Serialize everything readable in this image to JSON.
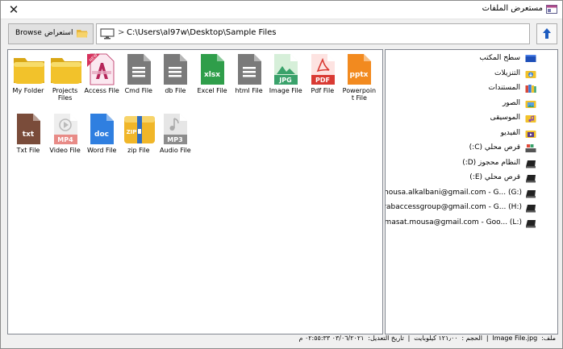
{
  "window": {
    "title": "مستعرض الملفات",
    "close_glyph": "✕"
  },
  "toolbar": {
    "browse_label_en": "Browse",
    "browse_label_ar": "استعراض",
    "path_separator": ">",
    "current_path": "C:\\Users\\al97w\\Desktop\\Sample Files"
  },
  "files": [
    {
      "name": "My Folder",
      "icon": "folder-icon"
    },
    {
      "name": "Projects Files",
      "icon": "folder-icon"
    },
    {
      "name": "Access File",
      "icon": "access-file-icon",
      "badge": "NEW"
    },
    {
      "name": "Cmd File",
      "icon": "cmd-file-icon"
    },
    {
      "name": "db File",
      "icon": "db-file-icon"
    },
    {
      "name": "Excel File",
      "icon": "excel-file-icon",
      "badge": "xlsx"
    },
    {
      "name": "html File",
      "icon": "html-file-icon"
    },
    {
      "name": "Image File",
      "icon": "image-file-icon",
      "badge": "JPG"
    },
    {
      "name": "Pdf File",
      "icon": "pdf-file-icon",
      "badge": "PDF"
    },
    {
      "name": "Powerpoint File",
      "icon": "powerpoint-file-icon",
      "badge": "pptx"
    },
    {
      "name": "Txt File",
      "icon": "txt-file-icon",
      "badge": "txt"
    },
    {
      "name": "Video File",
      "icon": "video-file-icon",
      "badge": "MP4"
    },
    {
      "name": "Word File",
      "icon": "word-file-icon",
      "badge": "doc"
    },
    {
      "name": "zip File",
      "icon": "zip-file-icon",
      "badge": "ZIP"
    },
    {
      "name": "Audio File",
      "icon": "audio-file-icon",
      "badge": "MP3"
    }
  ],
  "tree": [
    {
      "label": "سطح المكتب",
      "icon": "desktop-icon"
    },
    {
      "label": "التنزيلات",
      "icon": "downloads-icon"
    },
    {
      "label": "المستندات",
      "icon": "documents-icon"
    },
    {
      "label": "الصور",
      "icon": "pictures-icon"
    },
    {
      "label": "الموسيقى",
      "icon": "music-icon"
    },
    {
      "label": "الفيديو",
      "icon": "videos-icon"
    },
    {
      "label": "قرص محلي (C:)",
      "icon": "system-drive-icon"
    },
    {
      "label": "النظام محجوز (D:)",
      "icon": "drive-icon"
    },
    {
      "label": "قرص محلي (E:)",
      "icon": "drive-icon"
    },
    {
      "label": "mousa.alkalbani@gmail.com - G... (G:)",
      "icon": "drive-icon"
    },
    {
      "label": "rabaccessgroup@gmail.com - G... (H:)",
      "icon": "drive-icon"
    },
    {
      "label": "masat.mousa@gmail.com - Goo... (L:)",
      "icon": "drive-icon"
    }
  ],
  "status": {
    "file_label": "ملف:",
    "file_name": "Image File.jpg",
    "size_label": "الحجم :",
    "size_value": "١٢١٫٠٠ كيلوبايت",
    "modified_label": "تاريخ التعديل:",
    "modified_value": "٠٣/٠٦/٢٠٢١ ٠٢:٥٥:٣٣ م",
    "separator": "|"
  },
  "colors": {
    "folder": "#f2c22b",
    "access": "#b6265a",
    "gray_file": "#7a7a7a",
    "excel": "#2f9e4a",
    "image": "#3aa26b",
    "pdf": "#d93a33",
    "pptx": "#f28a1f",
    "txt": "#7a4c3a",
    "video": "#e88b87",
    "word": "#2f7fe0",
    "zip": "#f0b629",
    "audio": "#8c8c8c",
    "up_arrow": "#1c5bbf"
  }
}
